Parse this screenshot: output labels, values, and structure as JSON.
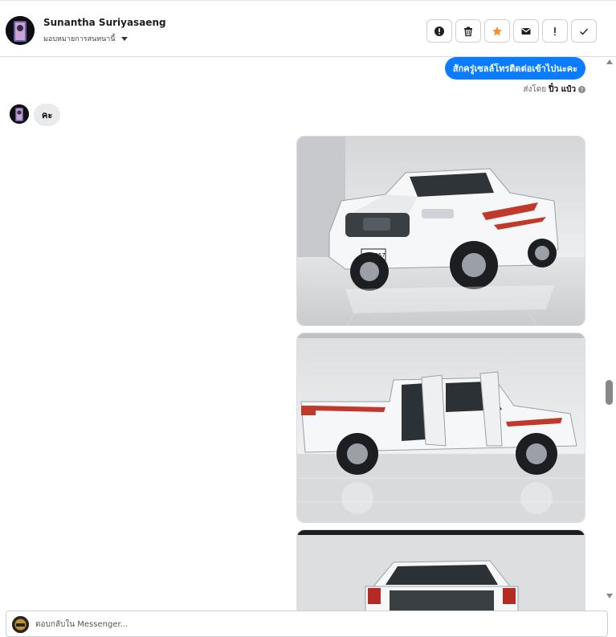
{
  "header": {
    "contact_name": "Sunantha Suriyasaeng",
    "assign_label": "มอบหมายการสนทนานี้"
  },
  "toolbar": {
    "actions": [
      {
        "name": "report-spam",
        "icon": "alert-circle-icon"
      },
      {
        "name": "delete",
        "icon": "trash-icon"
      },
      {
        "name": "star",
        "icon": "star-icon",
        "color": "#f5922f"
      },
      {
        "name": "mark-unread",
        "icon": "envelope-icon"
      },
      {
        "name": "follow-up",
        "icon": "exclamation-icon"
      },
      {
        "name": "done",
        "icon": "checkmark-icon"
      }
    ]
  },
  "messages": {
    "outgoing_text": "สักครู่เซลล์โทรติดต่อเข้าไปนะคะ",
    "sent_by_prefix": "ส่งโดย",
    "sent_by_name": "ปิ๋ว แป๋ว",
    "incoming_text": "คะ",
    "outgoing_color": "#0a7cff",
    "photos": [
      {
        "subject": "white pickup truck front three-quarter view",
        "plate": "ขค 7857"
      },
      {
        "subject": "white pickup truck side view with doors open"
      },
      {
        "subject": "white pickup truck rear view"
      }
    ]
  },
  "composer": {
    "placeholder": "ตอบกลับใน Messenger..."
  }
}
